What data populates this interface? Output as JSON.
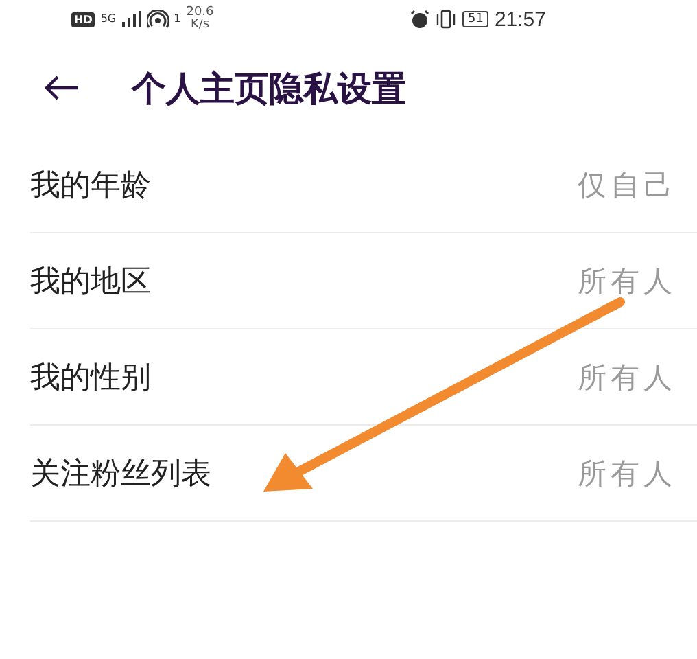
{
  "status_bar": {
    "hd_badge": "HD",
    "network": "5G",
    "wifi_count": "1",
    "speed": "20.6",
    "speed_unit": "K/s",
    "battery": "51",
    "time": "21:57"
  },
  "header": {
    "title": "个人主页隐私设置"
  },
  "rows": [
    {
      "label": "我的年龄",
      "value": "仅自己"
    },
    {
      "label": "我的地区",
      "value": "所有人"
    },
    {
      "label": "我的性别",
      "value": "所有人"
    },
    {
      "label": "关注粉丝列表",
      "value": "所有人"
    }
  ]
}
